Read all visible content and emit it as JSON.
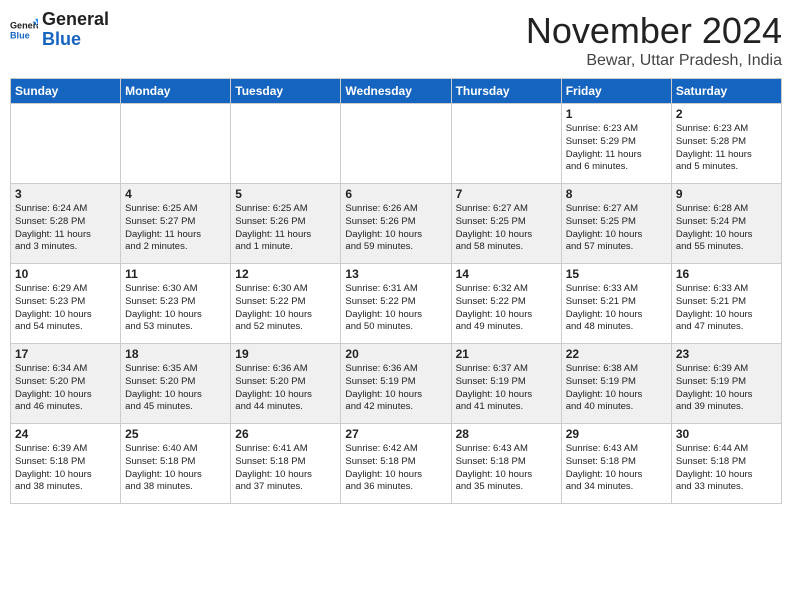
{
  "header": {
    "logo_line1": "General",
    "logo_line2": "Blue",
    "month": "November 2024",
    "location": "Bewar, Uttar Pradesh, India"
  },
  "weekdays": [
    "Sunday",
    "Monday",
    "Tuesday",
    "Wednesday",
    "Thursday",
    "Friday",
    "Saturday"
  ],
  "weeks": [
    [
      {
        "day": "",
        "info": ""
      },
      {
        "day": "",
        "info": ""
      },
      {
        "day": "",
        "info": ""
      },
      {
        "day": "",
        "info": ""
      },
      {
        "day": "",
        "info": ""
      },
      {
        "day": "1",
        "info": "Sunrise: 6:23 AM\nSunset: 5:29 PM\nDaylight: 11 hours\nand 6 minutes."
      },
      {
        "day": "2",
        "info": "Sunrise: 6:23 AM\nSunset: 5:28 PM\nDaylight: 11 hours\nand 5 minutes."
      }
    ],
    [
      {
        "day": "3",
        "info": "Sunrise: 6:24 AM\nSunset: 5:28 PM\nDaylight: 11 hours\nand 3 minutes."
      },
      {
        "day": "4",
        "info": "Sunrise: 6:25 AM\nSunset: 5:27 PM\nDaylight: 11 hours\nand 2 minutes."
      },
      {
        "day": "5",
        "info": "Sunrise: 6:25 AM\nSunset: 5:26 PM\nDaylight: 11 hours\nand 1 minute."
      },
      {
        "day": "6",
        "info": "Sunrise: 6:26 AM\nSunset: 5:26 PM\nDaylight: 10 hours\nand 59 minutes."
      },
      {
        "day": "7",
        "info": "Sunrise: 6:27 AM\nSunset: 5:25 PM\nDaylight: 10 hours\nand 58 minutes."
      },
      {
        "day": "8",
        "info": "Sunrise: 6:27 AM\nSunset: 5:25 PM\nDaylight: 10 hours\nand 57 minutes."
      },
      {
        "day": "9",
        "info": "Sunrise: 6:28 AM\nSunset: 5:24 PM\nDaylight: 10 hours\nand 55 minutes."
      }
    ],
    [
      {
        "day": "10",
        "info": "Sunrise: 6:29 AM\nSunset: 5:23 PM\nDaylight: 10 hours\nand 54 minutes."
      },
      {
        "day": "11",
        "info": "Sunrise: 6:30 AM\nSunset: 5:23 PM\nDaylight: 10 hours\nand 53 minutes."
      },
      {
        "day": "12",
        "info": "Sunrise: 6:30 AM\nSunset: 5:22 PM\nDaylight: 10 hours\nand 52 minutes."
      },
      {
        "day": "13",
        "info": "Sunrise: 6:31 AM\nSunset: 5:22 PM\nDaylight: 10 hours\nand 50 minutes."
      },
      {
        "day": "14",
        "info": "Sunrise: 6:32 AM\nSunset: 5:22 PM\nDaylight: 10 hours\nand 49 minutes."
      },
      {
        "day": "15",
        "info": "Sunrise: 6:33 AM\nSunset: 5:21 PM\nDaylight: 10 hours\nand 48 minutes."
      },
      {
        "day": "16",
        "info": "Sunrise: 6:33 AM\nSunset: 5:21 PM\nDaylight: 10 hours\nand 47 minutes."
      }
    ],
    [
      {
        "day": "17",
        "info": "Sunrise: 6:34 AM\nSunset: 5:20 PM\nDaylight: 10 hours\nand 46 minutes."
      },
      {
        "day": "18",
        "info": "Sunrise: 6:35 AM\nSunset: 5:20 PM\nDaylight: 10 hours\nand 45 minutes."
      },
      {
        "day": "19",
        "info": "Sunrise: 6:36 AM\nSunset: 5:20 PM\nDaylight: 10 hours\nand 44 minutes."
      },
      {
        "day": "20",
        "info": "Sunrise: 6:36 AM\nSunset: 5:19 PM\nDaylight: 10 hours\nand 42 minutes."
      },
      {
        "day": "21",
        "info": "Sunrise: 6:37 AM\nSunset: 5:19 PM\nDaylight: 10 hours\nand 41 minutes."
      },
      {
        "day": "22",
        "info": "Sunrise: 6:38 AM\nSunset: 5:19 PM\nDaylight: 10 hours\nand 40 minutes."
      },
      {
        "day": "23",
        "info": "Sunrise: 6:39 AM\nSunset: 5:19 PM\nDaylight: 10 hours\nand 39 minutes."
      }
    ],
    [
      {
        "day": "24",
        "info": "Sunrise: 6:39 AM\nSunset: 5:18 PM\nDaylight: 10 hours\nand 38 minutes."
      },
      {
        "day": "25",
        "info": "Sunrise: 6:40 AM\nSunset: 5:18 PM\nDaylight: 10 hours\nand 38 minutes."
      },
      {
        "day": "26",
        "info": "Sunrise: 6:41 AM\nSunset: 5:18 PM\nDaylight: 10 hours\nand 37 minutes."
      },
      {
        "day": "27",
        "info": "Sunrise: 6:42 AM\nSunset: 5:18 PM\nDaylight: 10 hours\nand 36 minutes."
      },
      {
        "day": "28",
        "info": "Sunrise: 6:43 AM\nSunset: 5:18 PM\nDaylight: 10 hours\nand 35 minutes."
      },
      {
        "day": "29",
        "info": "Sunrise: 6:43 AM\nSunset: 5:18 PM\nDaylight: 10 hours\nand 34 minutes."
      },
      {
        "day": "30",
        "info": "Sunrise: 6:44 AM\nSunset: 5:18 PM\nDaylight: 10 hours\nand 33 minutes."
      }
    ]
  ]
}
